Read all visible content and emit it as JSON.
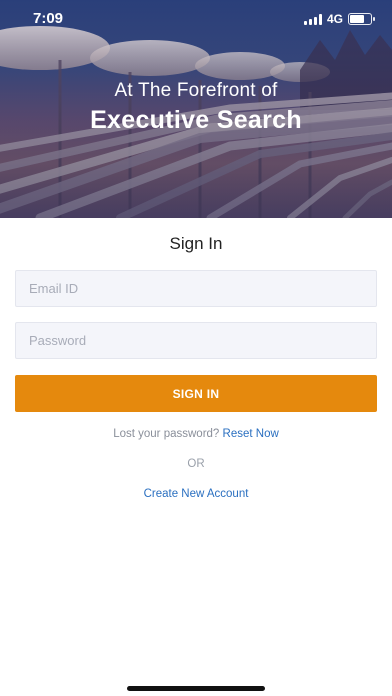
{
  "status_bar": {
    "time": "7:09",
    "network": "4G",
    "battery_level": 0.75
  },
  "hero": {
    "tagline": "At The Forefront of",
    "title": "Executive Search"
  },
  "form": {
    "heading": "Sign In",
    "email": {
      "placeholder": "Email ID",
      "value": ""
    },
    "password": {
      "placeholder": "Password",
      "value": ""
    },
    "submit_label": "SIGN IN",
    "lost_password_text": "Lost your password?",
    "reset_link_label": "Reset Now",
    "or_text": "OR",
    "create_account_label": "Create New Account"
  },
  "colors": {
    "accent": "#e5890d",
    "link": "#2a6fc0"
  }
}
